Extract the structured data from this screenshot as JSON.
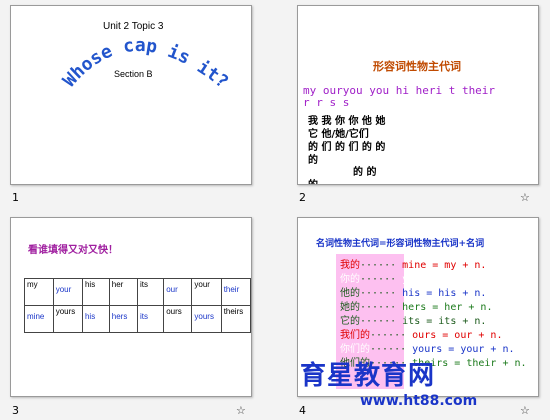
{
  "slides": [
    {
      "number": "1",
      "unit_topic": "Unit 2  Topic 3",
      "arc_title": "Whose cap is it?",
      "section": "Section B",
      "arc_color": "#2255cc"
    },
    {
      "number": "2",
      "title": "形容词性物主代词",
      "pronouns_row1": "my   ouryou  you  hi heri t   their",
      "pronouns_row2": "         r    r       s        s",
      "cn_row1": "我  我      你       你       他  她",
      "cn_row2": "它       他/她/它们",
      "cn_row3": "的  们     的       们       的  的",
      "cn_row4": "的",
      "cn_row5": "的                  的",
      "cn_row6": "的",
      "star": "☆"
    },
    {
      "number": "3",
      "title": "看谁填得又对又快！",
      "table": [
        [
          "my",
          "your",
          "his",
          "her",
          "its",
          "our",
          "your",
          "their"
        ],
        [
          "mine",
          "yours",
          "his",
          "hers",
          "its",
          "ours",
          "yours",
          "theirs"
        ]
      ],
      "blue_cells": [
        [
          0,
          1
        ],
        [
          0,
          5
        ],
        [
          0,
          7
        ],
        [
          1,
          0
        ],
        [
          1,
          2
        ],
        [
          1,
          3
        ],
        [
          1,
          4
        ],
        [
          1,
          6
        ]
      ],
      "star": "☆"
    },
    {
      "number": "4",
      "title": "名词性物主代词=形容词性物主代词+名词",
      "rows": [
        {
          "left": "我的",
          "dots": "······",
          "right": "mine = my + n."
        },
        {
          "left": "你的",
          "dots": "······",
          "right": "yours = your + n."
        },
        {
          "left": "他的",
          "dots": "······",
          "right": "his = his + n."
        },
        {
          "left": "她的",
          "dots": "······",
          "right": "hers = her + n."
        },
        {
          "left": "它的",
          "dots": "······",
          "right": "its = its + n."
        },
        {
          "left": "我们的",
          "dots": "······",
          "right": "ours = our + n."
        },
        {
          "left": "你们的",
          "dots": "······",
          "right": "yours = your + n."
        },
        {
          "left": "他们的",
          "dots": "······",
          "right": "theirs = their + n."
        }
      ],
      "star": "☆"
    }
  ],
  "watermark": {
    "logo": "育星教育网",
    "url": "www.ht88.com"
  }
}
